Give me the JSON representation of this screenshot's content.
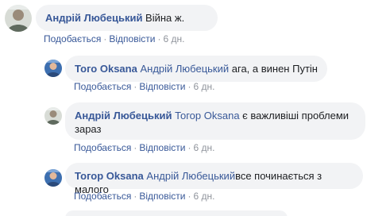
{
  "comments": [
    {
      "author": "Андрій Любецький",
      "mention": "",
      "text": " Війна ж.",
      "like_label": "Подобається",
      "reply_label": "Відповісти",
      "time": "6 дн.",
      "separator": "·"
    },
    {
      "author": "Того Oksana",
      "mention": "Андрій Любецький",
      "text": " ага, а винен Путін",
      "like_label": "Подобається",
      "reply_label": "Відповісти",
      "time": "6 дн.",
      "separator": "·"
    },
    {
      "author": "Андрій Любецький",
      "mention": "Тогор Oksana",
      "text": " є важливіші проблеми зараз",
      "like_label": "Подобається",
      "reply_label": "Відповісти",
      "time": "6 дн.",
      "separator": "·"
    },
    {
      "author": "Тогор Oksana",
      "mention": "Андрій Любецький",
      "text": "все починається з малого",
      "like_label": "Подобається",
      "reply_label": "Відповісти",
      "time": "6 дн.",
      "separator": "·"
    }
  ],
  "colors": {
    "link": "#385898",
    "bubble": "#f2f3f5",
    "meta": "#90949c",
    "text": "#1c1e21"
  },
  "icons": [
    "avatar-andriy-icon",
    "avatar-oksana-icon"
  ]
}
